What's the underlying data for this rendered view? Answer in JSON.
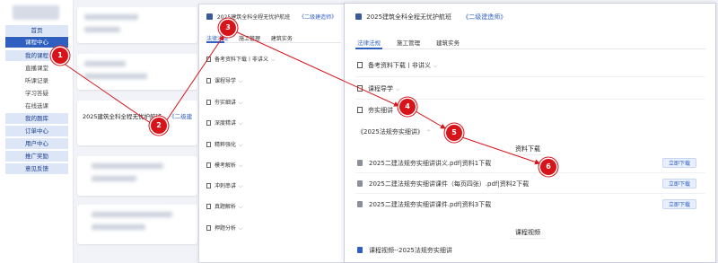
{
  "sidebar": {
    "items": [
      {
        "label": "首页"
      },
      {
        "label": "课程中心"
      },
      {
        "label": "我的课程"
      },
      {
        "label": "直播课堂"
      },
      {
        "label": "听课记录"
      },
      {
        "label": "学习答疑"
      },
      {
        "label": "在线选课"
      },
      {
        "label": "我的题库"
      },
      {
        "label": "订单中心"
      },
      {
        "label": "用户中心"
      },
      {
        "label": "推广奖励"
      },
      {
        "label": "意见反馈"
      }
    ]
  },
  "background_list": {
    "visible_title": "2025建筑全科全程无忧护航班",
    "visible_tag": "《二级建"
  },
  "middle_panel": {
    "course_name": "2025建筑全科全程无忧护航班",
    "course_tag": "《二级建造师》",
    "tabs": [
      "法律法规",
      "施工管理",
      "建筑实务"
    ],
    "items": [
      {
        "label": "备考资料下载丨非讲义"
      },
      {
        "label": "课程导学"
      },
      {
        "label": "夯实细讲"
      },
      {
        "label": "深度精讲"
      },
      {
        "label": "精粹强化"
      },
      {
        "label": "模考解析"
      },
      {
        "label": "冲刺串讲"
      },
      {
        "label": "真题解析"
      },
      {
        "label": "押题分析"
      }
    ]
  },
  "right_panel": {
    "course_name": "2025建筑全科全程无忧护航班",
    "course_tag": "《二级建造师》",
    "tabs": [
      "法律法规",
      "施工管理",
      "建筑实务"
    ],
    "sections": [
      {
        "label": "备考资料下载丨非讲义"
      },
      {
        "label": "课程导学"
      },
      {
        "label": "夯实细讲"
      }
    ],
    "subsection": "《2025法规夯实细讲》",
    "downloads_heading": "资料下载",
    "files": [
      {
        "name": "2025二建法规夯实细讲讲义.pdf|资料1下载",
        "button": "立即下载"
      },
      {
        "name": "2025二建法规夯实细讲课件（每页四张）.pdf|资料2下载",
        "button": "立即下载"
      },
      {
        "name": "2025二建法规夯实细讲课件.pdf|资料3下载",
        "button": "立即下载"
      }
    ],
    "video_heading": "课程视频",
    "video_link": "课程视频--2025法规夯实细讲"
  },
  "annotations": {
    "markers": [
      "1",
      "2",
      "3",
      "4",
      "5",
      "6"
    ],
    "color": "#d8141b"
  },
  "colors": {
    "accent": "#2f5fbf",
    "sidebar_active": "#2f5fbf",
    "sidebar_main": "#dce6f7"
  }
}
